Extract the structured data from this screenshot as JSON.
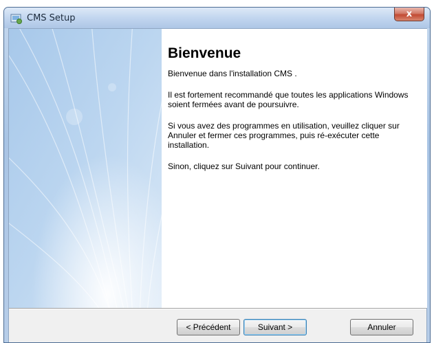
{
  "window": {
    "title": "CMS Setup",
    "close_label": "x"
  },
  "content": {
    "heading": "Bienvenue",
    "paragraphs": [
      "Bienvenue dans l'installation CMS .",
      "Il est fortement recommandé que toutes les applications Windows soient fermées avant de poursuivre.",
      "Si vous avez des programmes en utilisation, veuillez cliquer sur Annuler et fermer ces programmes, puis ré-exécuter cette installation.",
      "Sinon, cliquez sur Suivant pour continuer."
    ]
  },
  "buttons": {
    "previous": "< Précédent",
    "next": "Suivant >",
    "cancel": "Annuler"
  },
  "icons": {
    "app": "setup-icon",
    "close": "close-icon"
  }
}
